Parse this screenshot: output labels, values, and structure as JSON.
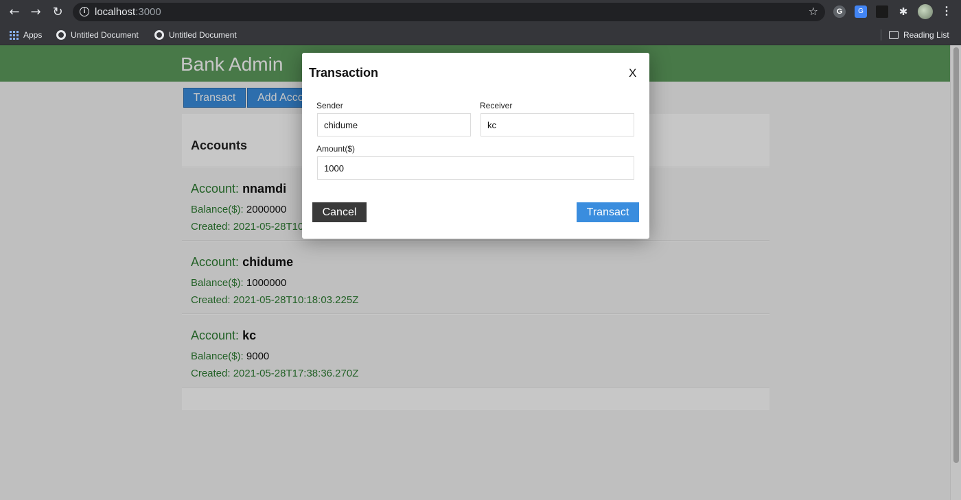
{
  "browser": {
    "url_host": "localhost",
    "url_port": ":3000",
    "bookmarks": [
      {
        "label": "Apps"
      },
      {
        "label": "Untitled Document"
      },
      {
        "label": "Untitled Document"
      }
    ],
    "reading_list": "Reading List",
    "nav": {
      "back": "←",
      "forward": "→",
      "reload": "↻"
    },
    "star": "☆",
    "extensions": {
      "grammarly": "G",
      "translate": "G",
      "puzzle": "✱",
      "menu": "⋮"
    }
  },
  "app": {
    "title": "Bank Admin",
    "tabs": [
      {
        "label": "Transact"
      },
      {
        "label": "Add Account"
      }
    ],
    "accounts_heading": "Accounts",
    "account_prefix": "Account:",
    "balance_prefix": "Balance($):",
    "created_prefix": "Created:",
    "accounts": [
      {
        "name": "nnamdi",
        "balance": "2000000",
        "created": "2021-05-28T10:17:51.121Z"
      },
      {
        "name": "chidume",
        "balance": "1000000",
        "created": "2021-05-28T10:18:03.225Z"
      },
      {
        "name": "kc",
        "balance": "9000",
        "created": "2021-05-28T17:38:36.270Z"
      }
    ]
  },
  "modal": {
    "title": "Transaction",
    "close": "X",
    "sender_label": "Sender",
    "sender_value": "chidume",
    "receiver_label": "Receiver",
    "receiver_value": "kc",
    "amount_label": "Amount($)",
    "amount_value": "1000",
    "cancel": "Cancel",
    "submit": "Transact"
  },
  "colors": {
    "header": "#5d9b5d",
    "primary": "#3a8dde",
    "dark_button": "#3a3a3a",
    "account_text": "#2e7d32"
  }
}
